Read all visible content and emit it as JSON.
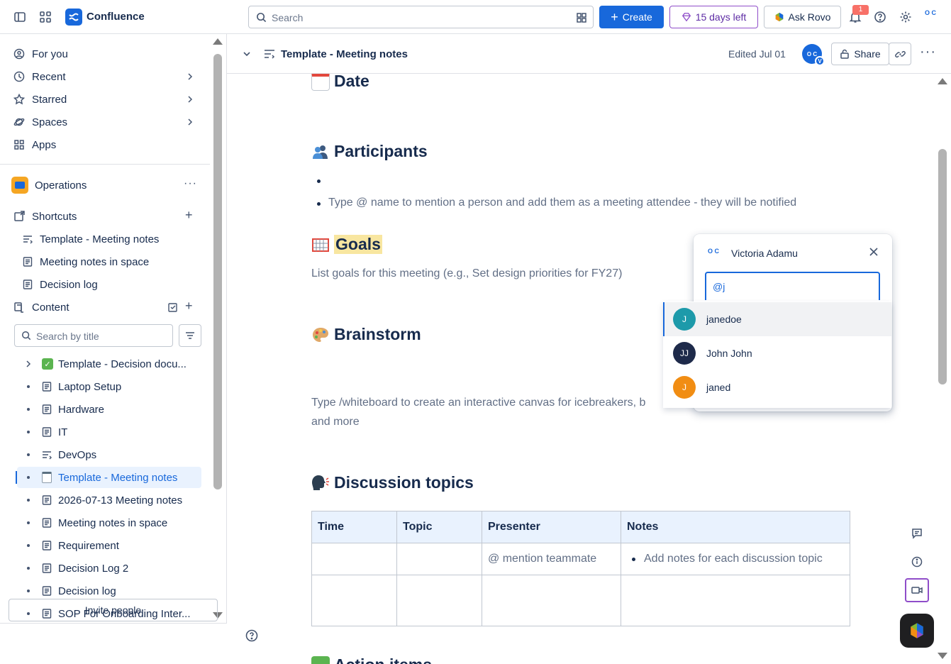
{
  "topbar": {
    "brand": "Confluence",
    "search_placeholder": "Search",
    "create_label": "Create",
    "trial_label": "15 days left",
    "rovo_label": "Ask Rovo",
    "notifications_count": "1",
    "org_badge": "O C"
  },
  "sidebar": {
    "nav": [
      {
        "label": "For you",
        "icon": "user-circle-icon"
      },
      {
        "label": "Recent",
        "icon": "clock-icon"
      },
      {
        "label": "Starred",
        "icon": "star-icon"
      },
      {
        "label": "Spaces",
        "icon": "planet-icon"
      },
      {
        "label": "Apps",
        "icon": "apps-grid-icon"
      }
    ],
    "space_name": "Operations",
    "shortcuts_label": "Shortcuts",
    "shortcuts": [
      "Template - Meeting notes",
      "Meeting notes in space",
      "Decision log"
    ],
    "content_label": "Content",
    "search_placeholder": "Search by title",
    "tree": [
      {
        "label": "Template - Decision docu...",
        "icon": "check-emoji-icon",
        "expand": true
      },
      {
        "label": "Laptop Setup",
        "icon": "page-icon"
      },
      {
        "label": "Hardware",
        "icon": "page-icon"
      },
      {
        "label": "IT",
        "icon": "page-icon"
      },
      {
        "label": "DevOps",
        "icon": "template-icon"
      },
      {
        "label": "Template - Meeting notes",
        "icon": "notepad-emoji-icon",
        "active": true
      },
      {
        "label": "2026-07-13 Meeting notes",
        "icon": "page-icon"
      },
      {
        "label": "Meeting notes in space",
        "icon": "page-icon"
      },
      {
        "label": "Requirement",
        "icon": "page-icon"
      },
      {
        "label": "Decision Log 2",
        "icon": "page-icon"
      },
      {
        "label": "Decision log",
        "icon": "page-icon"
      },
      {
        "label": "SOP For Onboarding Inter...",
        "icon": "page-icon"
      }
    ],
    "invite_label": "Invite people"
  },
  "page_header": {
    "title": "Template - Meeting notes",
    "edited": "Edited Jul 01",
    "avatar_initials": "O C",
    "avatar_badge": "V",
    "share_label": "Share"
  },
  "content": {
    "date_heading": "Date",
    "participants_heading": "Participants",
    "participants_hint": "Type @ name to mention a person and add them as a meeting attendee - they will be notified",
    "goals_heading": "Goals",
    "goals_hint": "List goals for this meeting (e.g., Set design priorities for FY27)",
    "brainstorm_heading": "Brainstorm",
    "brainstorm_hint": "Type /whiteboard to create an interactive canvas for icebreakers, b",
    "brainstorm_hint_2": "and more",
    "discussion_heading": "Discussion topics",
    "table": {
      "headers": [
        "Time",
        "Topic",
        "Presenter",
        "Notes"
      ],
      "row1": {
        "presenter": "@ mention teammate",
        "notes": "Add notes for each discussion topic"
      }
    },
    "next_heading_partial": "Action items"
  },
  "mention_card": {
    "user_name": "Victoria Adamu",
    "input_value": "@j",
    "suggestions": [
      {
        "name": "janedoe",
        "initial": "J",
        "color": "#1d9aaa"
      },
      {
        "name": "John John",
        "initial": "JJ",
        "color": "#1e2a4a"
      },
      {
        "name": "janed",
        "initial": "J",
        "color": "#f18d13"
      }
    ]
  },
  "colors": {
    "accent": "#1868db",
    "trial": "#8f4dc9",
    "highlight": "#f8e6a0"
  }
}
